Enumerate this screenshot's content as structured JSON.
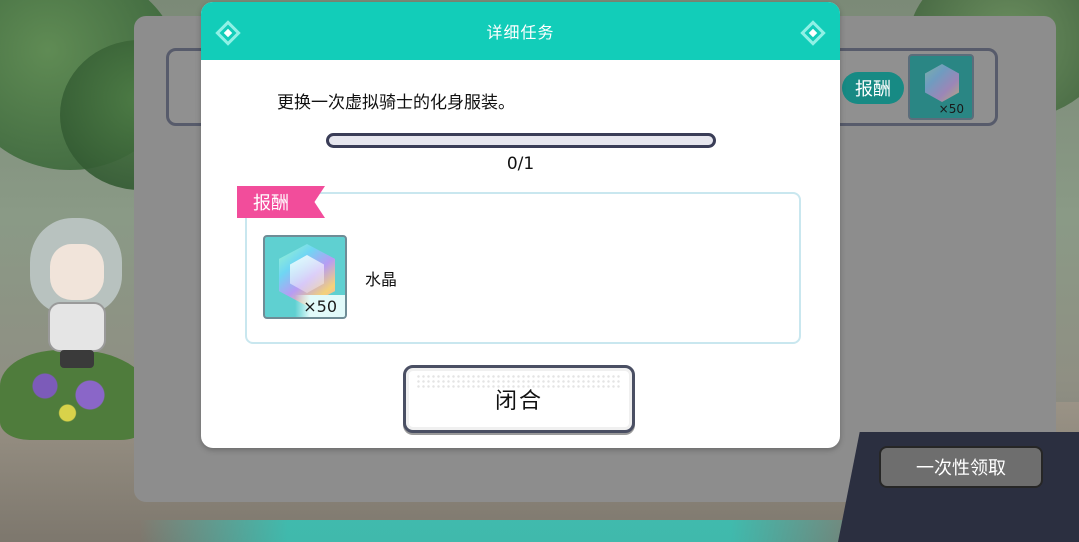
{
  "background_panel": {
    "reward_tag": "报酬",
    "crystal_quantity": "×50",
    "claim_all_label": "一次性领取"
  },
  "dialog": {
    "title": "详细任务",
    "mission_description": "更换一次虚拟骑士的化身服装。",
    "progress": {
      "text": "0/1",
      "current": 0,
      "target": 1
    },
    "reward_section": {
      "ribbon_label": "报酬",
      "item": {
        "name": "水晶",
        "quantity": "×50",
        "icon": "crystal-icon"
      }
    },
    "close_label": "闭合"
  },
  "colors": {
    "header_teal": "#12cdb9",
    "ribbon_pink": "#f24d9b",
    "progress_track": "#3a3d57"
  }
}
